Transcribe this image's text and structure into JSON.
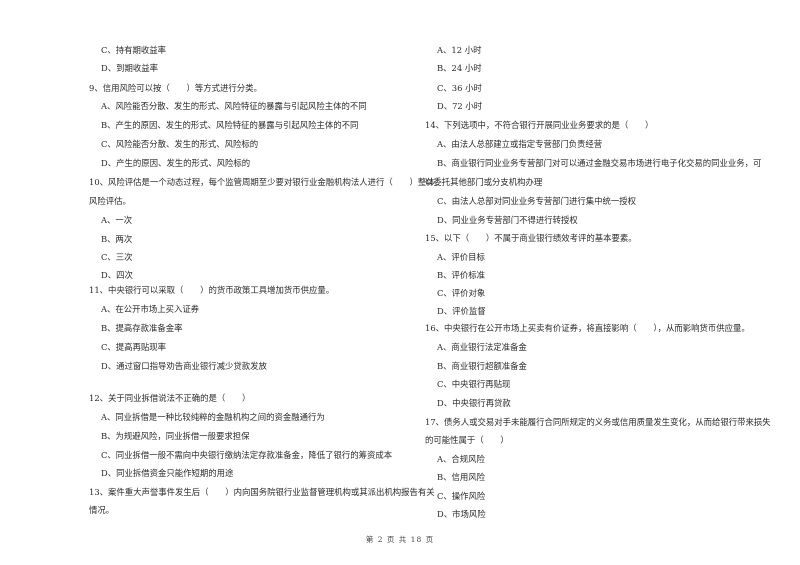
{
  "document": {
    "left_column": [
      {
        "type": "option",
        "text": "C、持有期收益率"
      },
      {
        "type": "option",
        "text": "D、到期收益率"
      },
      {
        "type": "question",
        "text": "9、信用风险可以按（　　）等方式进行分类。"
      },
      {
        "type": "option",
        "text": "A、风险能否分散、发生的形式、风险特征的暴露与引起风险主体的不同"
      },
      {
        "type": "option",
        "text": "B、产生的原因、发生的形式、风险特征的暴露与引起风险主体的不同"
      },
      {
        "type": "option",
        "text": "C、风险能否分散、发生的形式、风险标的"
      },
      {
        "type": "option",
        "text": "D、产生的原因、发生的形式、风险标的"
      },
      {
        "type": "question",
        "text": "10、风险评估是一个动态过程，每个监管周期至少要对银行业金融机构法人进行（　　）整体"
      },
      {
        "type": "question-cont",
        "text": "风险评估。"
      },
      {
        "type": "option",
        "text": "A、一次"
      },
      {
        "type": "option",
        "text": "B、两次"
      },
      {
        "type": "option",
        "text": "C、三次"
      },
      {
        "type": "option",
        "text": "D、四次"
      },
      {
        "type": "question",
        "text": "11、中央银行可以采取（　　）的货币政策工具增加货币供应量。"
      },
      {
        "type": "option",
        "text": "A、在公开市场上买入证券"
      },
      {
        "type": "option",
        "text": "B、提高存款准备金率"
      },
      {
        "type": "option",
        "text": "C、提高再贴现率"
      },
      {
        "type": "option",
        "text": "D、通过窗口指导劝告商业银行减少贷款发放"
      },
      {
        "type": "question",
        "text": "12、关于同业拆借说法不正确的是（　　）"
      },
      {
        "type": "option",
        "text": "A、同业拆借是一种比较纯粹的金融机构之间的资金融通行为"
      },
      {
        "type": "option",
        "text": "B、为规避风险，同业拆借一般要求担保"
      },
      {
        "type": "option",
        "text": "C、同业拆借一般不需向中央银行缴纳法定存款准备金，降低了银行的筹资成本"
      },
      {
        "type": "option",
        "text": "D、同业拆借资金只能作短期的用途"
      },
      {
        "type": "question",
        "text": "13、案件重大声誉事件发生后（　　）内向国务院银行业监督管理机构或其派出机构报告有关"
      },
      {
        "type": "question-cont",
        "text": "情况。"
      }
    ],
    "right_column": [
      {
        "type": "option",
        "text": "A、12 小时"
      },
      {
        "type": "option",
        "text": "B、24 小时"
      },
      {
        "type": "option",
        "text": "C、36 小时"
      },
      {
        "type": "option",
        "text": "D、72 小时"
      },
      {
        "type": "question",
        "text": "14、下列选项中，不符合银行开展同业业务要求的是（　　）"
      },
      {
        "type": "option",
        "text": "A、由法人总部建立或指定专营部门负责经营"
      },
      {
        "type": "option",
        "text": "B、商业银行同业业务专营部门对可以通过金融交易市场进行电子化交易的同业业务，可"
      },
      {
        "type": "question-cont",
        "text": "以委托其他部门或分支机构办理"
      },
      {
        "type": "option",
        "text": "C、由法人总部对同业业务专营部门进行集中统一授权"
      },
      {
        "type": "option",
        "text": "D、同业业务专营部门不得进行转授权"
      },
      {
        "type": "question",
        "text": "15、以下（　　）不属于商业银行绩效考评的基本要素。"
      },
      {
        "type": "option",
        "text": "A、评价目标"
      },
      {
        "type": "option",
        "text": "B、评价标准"
      },
      {
        "type": "option",
        "text": "C、评价对象"
      },
      {
        "type": "option",
        "text": "D、评价监督"
      },
      {
        "type": "question",
        "text": "16、中央银行在公开市场上买卖有价证券，将直接影响（　　），从而影响货币供应量。"
      },
      {
        "type": "option",
        "text": "A、商业银行法定准备金"
      },
      {
        "type": "option",
        "text": "B、商业银行超额准备金"
      },
      {
        "type": "option",
        "text": "C、中央银行再贴现"
      },
      {
        "type": "option",
        "text": "D、中央银行再贷款"
      },
      {
        "type": "question",
        "text": "17、债务人或交易对手未能履行合同所规定的义务或信用质量发生变化，从而给银行带来损失"
      },
      {
        "type": "question-cont",
        "text": "的可能性属于（　　）"
      },
      {
        "type": "option",
        "text": "A、合规风险"
      },
      {
        "type": "option",
        "text": "B、信用风险"
      },
      {
        "type": "option",
        "text": "C、操作风险"
      },
      {
        "type": "option",
        "text": "D、市场风险"
      }
    ],
    "footer": "第 2 页 共 18 页"
  }
}
